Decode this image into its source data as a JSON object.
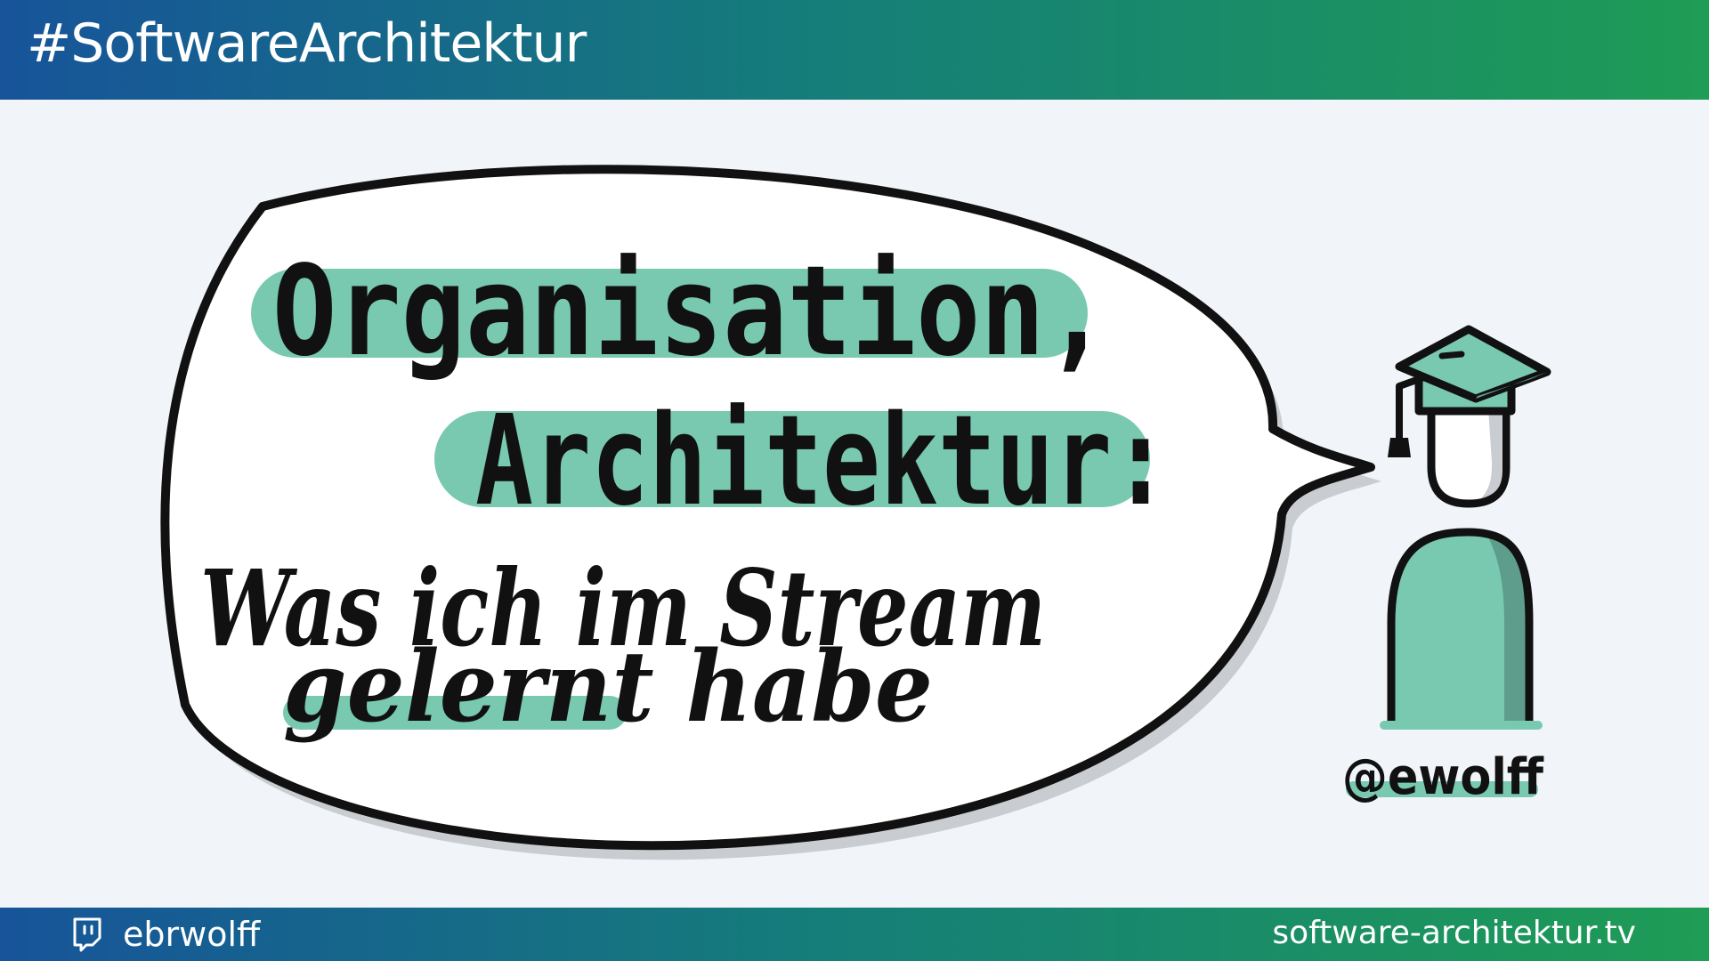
{
  "header": {
    "hashtag": "#SoftwareArchitektur"
  },
  "speech": {
    "line1": "Organisation,",
    "line2": "Architektur:",
    "line3": "Was ich im Stream",
    "line4": "gelernt habe"
  },
  "character": {
    "handle": "@ewolff"
  },
  "footer": {
    "icon": "twitch-icon",
    "twitch_handle": "ebrwolff",
    "url": "software-architektur.tv"
  },
  "colors": {
    "header_gradient": [
      "#17549a",
      "#157f78",
      "#1f9c55"
    ],
    "highlight": "#79c9b1",
    "background": "#f1f5fa",
    "ink": "#111111"
  }
}
